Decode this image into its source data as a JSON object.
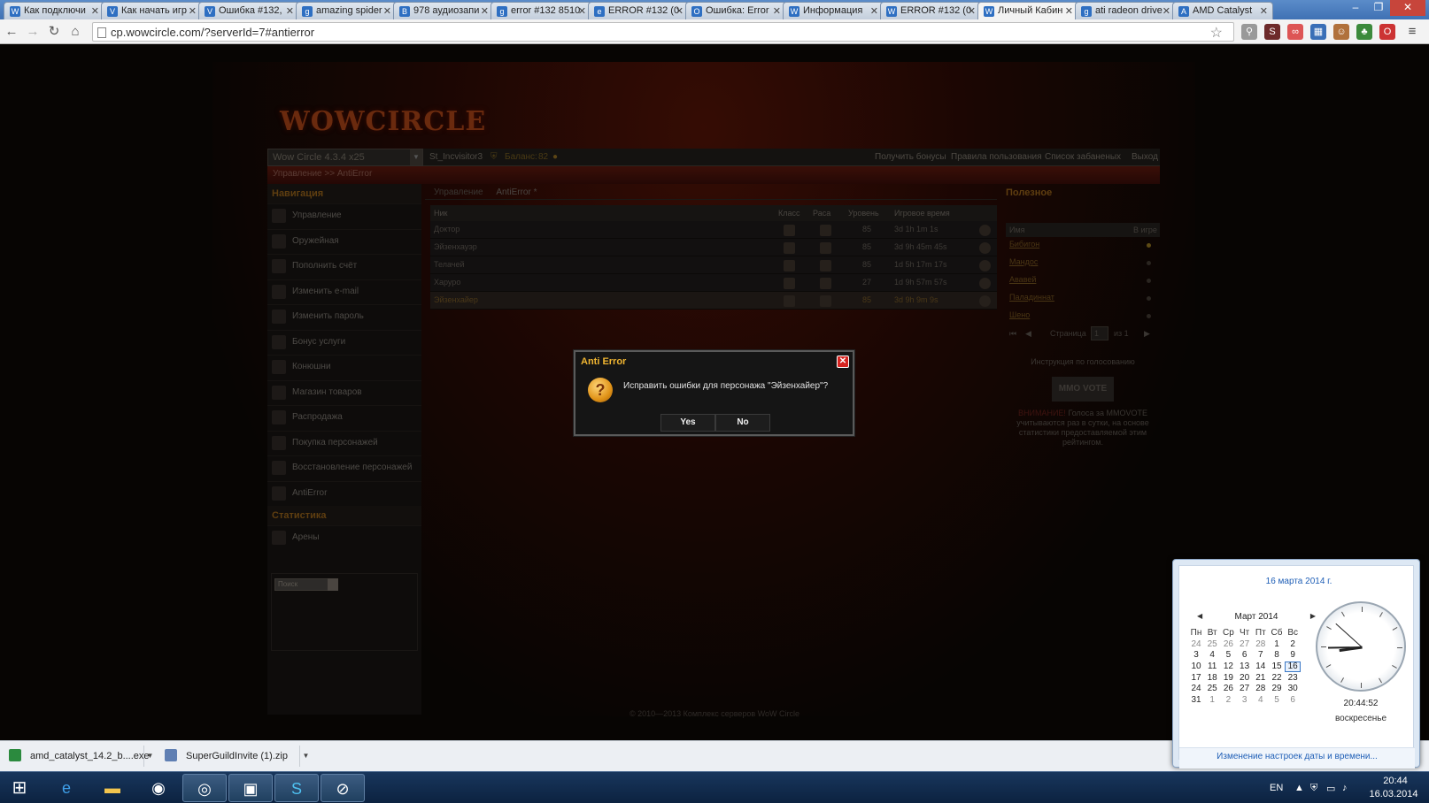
{
  "browser": {
    "tabs": [
      {
        "title": "Как подключи",
        "icon": "W"
      },
      {
        "title": "Как начать игр",
        "icon": "V"
      },
      {
        "title": "Ошибка #132,",
        "icon": "V"
      },
      {
        "title": "amazing spider",
        "icon": "g"
      },
      {
        "title": "978 аудиозапи",
        "icon": "B"
      },
      {
        "title": "error #132 8510",
        "icon": "g"
      },
      {
        "title": "ERROR #132 (0",
        "icon": "e"
      },
      {
        "title": "Ошибка: Error",
        "icon": "O"
      },
      {
        "title": "Информация",
        "icon": "W"
      },
      {
        "title": "ERROR #132 (0",
        "icon": "W"
      },
      {
        "title": "Личный Кабин",
        "icon": "W"
      },
      {
        "title": "ati radeon drive",
        "icon": "g"
      },
      {
        "title": "AMD Catalyst",
        "icon": "A"
      }
    ],
    "active_tab_index": 10,
    "url": "cp.wowcircle.com/?serverId=7#antierror"
  },
  "site": {
    "logo_text": "WOWCIRCLE",
    "server_select": "Wow Circle 4.3.4 x25",
    "username": "St_Incvisitor3",
    "balance_label": "Баланс:",
    "balance_value": "82",
    "top_links": [
      "Получить бонусы",
      "Правила пользования",
      "Список забаненых",
      "Выход"
    ],
    "breadcrumb": "Управление >> AntiError",
    "nav_header": "Навигация",
    "nav_items": [
      "Управление",
      "Оружейная",
      "Пополнить счёт",
      "Изменить e-mail",
      "Изменить пароль",
      "Бонус услуги",
      "Конюшни",
      "Магазин товаров",
      "Распродажа",
      "Покупка персонажей",
      "Восстановление персонажей",
      "AntiError"
    ],
    "stats_header": "Статистика",
    "stats_items": [
      "Арены"
    ],
    "search_placeholder": "Поиск",
    "center_tabs": [
      "Управление",
      "AntiError *"
    ],
    "table": {
      "headers": [
        "Ник",
        "Класс",
        "Раса",
        "Уровень",
        "Игровое время"
      ],
      "rows": [
        {
          "name": "Доктор",
          "level": "85",
          "time": "3d 1h 1m 1s"
        },
        {
          "name": "Эйзенхауэр",
          "level": "85",
          "time": "3d 9h 45m 45s"
        },
        {
          "name": "Телачей",
          "level": "85",
          "time": "1d 5h 17m 17s"
        },
        {
          "name": "Харуро",
          "level": "27",
          "time": "1d 9h 57m 57s"
        },
        {
          "name": "Эйзенхайер",
          "level": "85",
          "time": "3d 9h 9m 9s"
        }
      ],
      "selected_row_index": 4
    },
    "useful": {
      "header": "Полезное",
      "col_name": "Имя",
      "col_status": "В игре",
      "items": [
        {
          "name": "Бибигон",
          "online": true
        },
        {
          "name": "Мандос",
          "online": false
        },
        {
          "name": "Ававей",
          "online": false
        },
        {
          "name": "Паладиннат",
          "online": false
        },
        {
          "name": "Шено",
          "online": false
        }
      ],
      "pager": {
        "page_label": "Страница",
        "page": "1",
        "of_label": "из 1"
      }
    },
    "vote": {
      "title": "Инструкция по голосованию",
      "logo": "MMO VOTE",
      "warning": "ВНИМАНИЕ!",
      "text": "Голоса за MMOVOTE учитываются раз в сутки, на основе статистики предоставляемой этим рейтингом."
    },
    "footer": "© 2010—2013 Комплекс серверов WoW Circle"
  },
  "dialog": {
    "title": "Anti Error",
    "message": "Исправить ошибки для персонажа \"Эйзенхайер\"?",
    "yes": "Yes",
    "no": "No"
  },
  "downloads": [
    {
      "name": "amd_catalyst_14.2_b....exe"
    },
    {
      "name": "SuperGuildInvite (1).zip"
    }
  ],
  "calendar": {
    "full_date": "16 марта 2014 г.",
    "month": "Март 2014",
    "weekdays": [
      "Пн",
      "Вт",
      "Ср",
      "Чт",
      "Пт",
      "Сб",
      "Вс"
    ],
    "weeks": [
      [
        "24",
        "25",
        "26",
        "27",
        "28",
        "1",
        "2"
      ],
      [
        "3",
        "4",
        "5",
        "6",
        "7",
        "8",
        "9"
      ],
      [
        "10",
        "11",
        "12",
        "13",
        "14",
        "15",
        "16"
      ],
      [
        "17",
        "18",
        "19",
        "20",
        "21",
        "22",
        "23"
      ],
      [
        "24",
        "25",
        "26",
        "27",
        "28",
        "29",
        "30"
      ],
      [
        "31",
        "1",
        "2",
        "3",
        "4",
        "5",
        "6"
      ]
    ],
    "today": "16",
    "clock_time": "20:44:52",
    "weekday_name": "воскресенье",
    "settings_link": "Изменение настроек даты и времени..."
  },
  "tray": {
    "lang": "EN",
    "time": "20:44",
    "date": "16.03.2014"
  }
}
